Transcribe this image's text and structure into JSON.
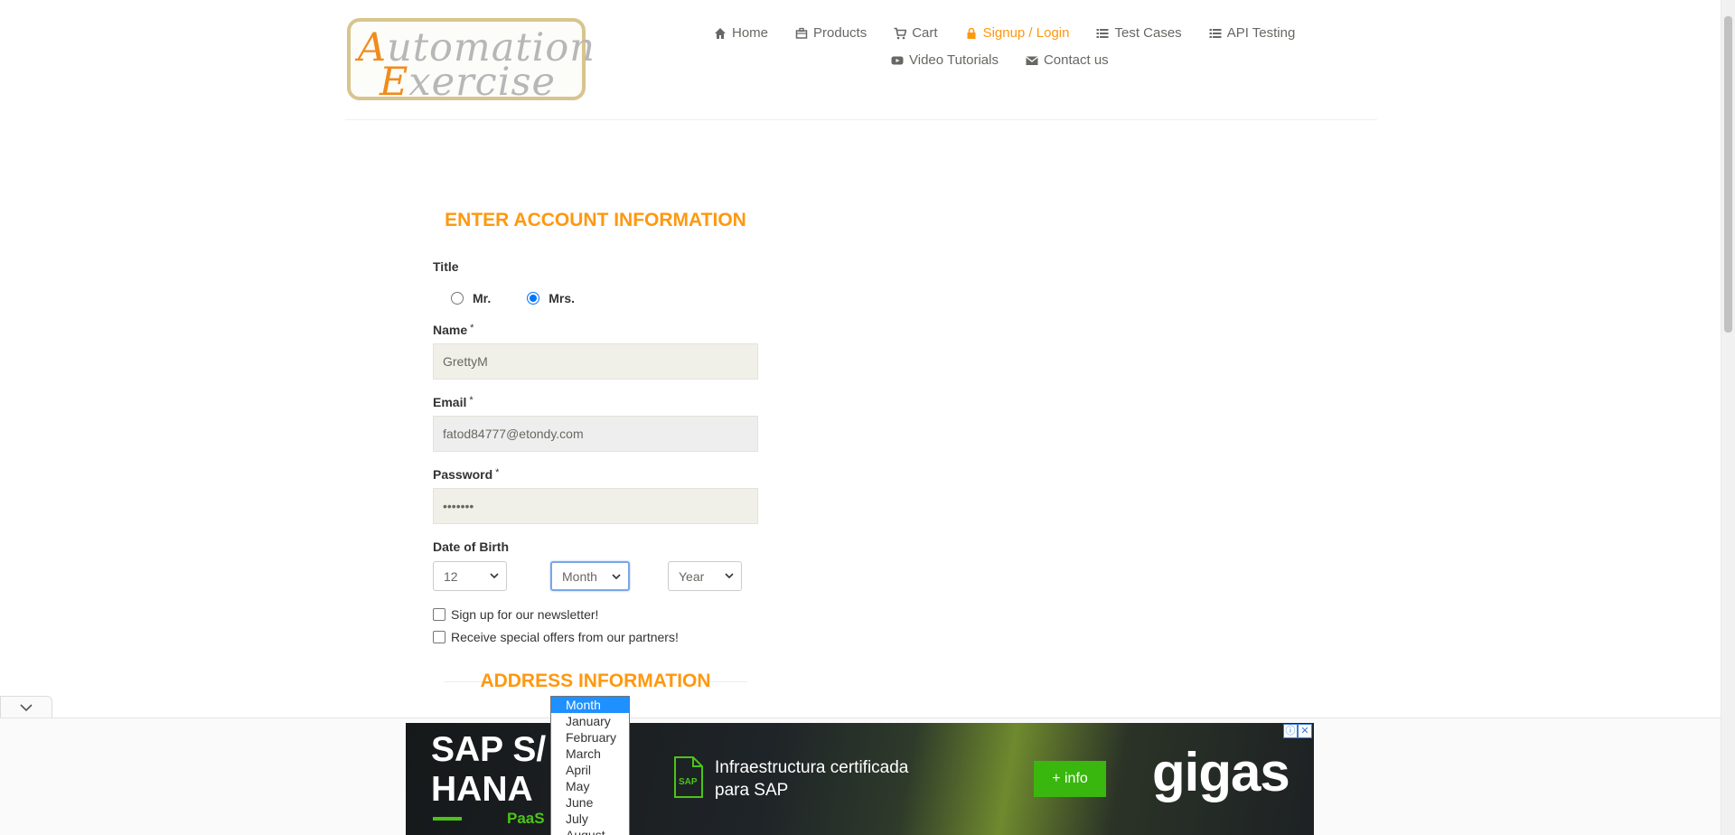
{
  "logo": {
    "line1_cap": "A",
    "line1_rest": "utomation",
    "line2_cap": "E",
    "line2_rest": "xercise"
  },
  "nav": {
    "row1": [
      {
        "label": "Home",
        "icon": "home-icon"
      },
      {
        "label": "Products",
        "icon": "products-icon"
      },
      {
        "label": "Cart",
        "icon": "cart-icon"
      },
      {
        "label": "Signup / Login",
        "icon": "lock-icon",
        "active": true
      },
      {
        "label": "Test Cases",
        "icon": "list-icon"
      },
      {
        "label": "API Testing",
        "icon": "list-icon"
      }
    ],
    "row2": [
      {
        "label": "Video Tutorials",
        "icon": "youtube-icon"
      },
      {
        "label": "Contact us",
        "icon": "envelope-icon"
      }
    ]
  },
  "form": {
    "heading": "ENTER ACCOUNT INFORMATION",
    "title_label": "Title",
    "mr_label": "Mr.",
    "mrs_label": "Mrs.",
    "selected_title": "Mrs.",
    "name_label": "Name",
    "name_value": "GrettyM",
    "email_label": "Email",
    "email_value": "fatod84777@etondy.com",
    "password_label": "Password",
    "password_value": "•••••••",
    "required_mark": "*",
    "dob_label": "Date of Birth",
    "day_value": "12",
    "month_value": "Month",
    "year_value": "Year",
    "newsletter_label": "Sign up for our newsletter!",
    "offers_label": "Receive special offers from our partners!",
    "address_heading": "ADDRESS INFORMATION"
  },
  "month_dropdown": {
    "options": [
      "Month",
      "January",
      "February",
      "March",
      "April",
      "May",
      "June",
      "July",
      "August"
    ],
    "selected": "Month"
  },
  "ad": {
    "product_line1": "SAP S/",
    "product_line2": "HANA",
    "paas": "PaaS",
    "cert_line1": "Infraestructura certificada",
    "cert_line2": "para SAP",
    "cert_icon_text": "SAP",
    "button": "+ info",
    "brand": "gigas",
    "info_icon": "ⓘ",
    "close_icon": "✕"
  },
  "colors": {
    "accent": "#fe980f",
    "text": "#696763",
    "input_bg": "#f0f0e9",
    "ad_green": "#3ab70f"
  }
}
